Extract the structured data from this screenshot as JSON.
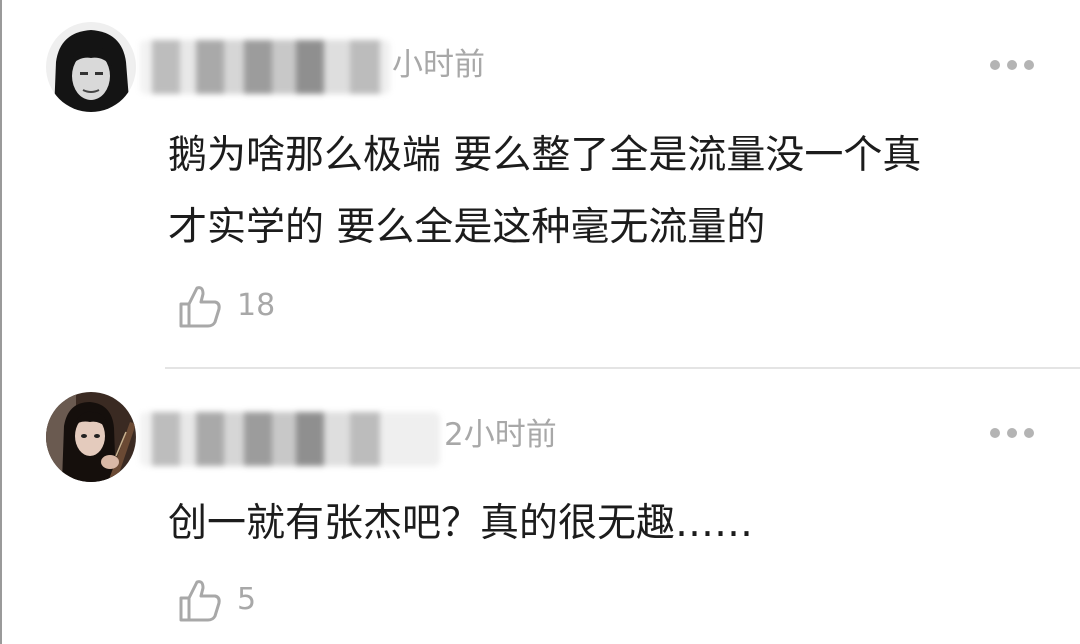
{
  "comments": [
    {
      "time_suffix": "小时前",
      "text": "鹅为啥那么极端 要么整了全是流量没一个真\n才实学的 要么全是这种毫无流量的",
      "likes": "18",
      "avatar_icon": "user-avatar-man-long-hair",
      "more_icon": "more-dots-icon",
      "like_icon": "thumbs-up-icon"
    },
    {
      "time_suffix": "2小时前",
      "text": "创一就有张杰吧？真的很无趣……",
      "likes": "5",
      "avatar_icon": "user-avatar-woman-guitar",
      "more_icon": "more-dots-icon",
      "like_icon": "thumbs-up-icon"
    }
  ],
  "colors": {
    "text": "#1c1c1c",
    "meta": "#a8a8a8",
    "divider": "#e4e4e4"
  }
}
